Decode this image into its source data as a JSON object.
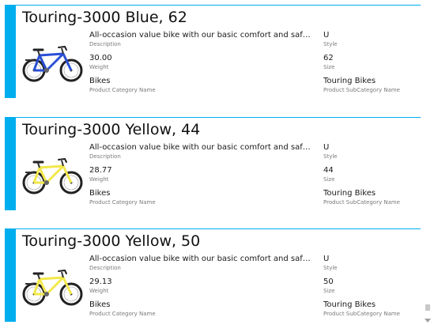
{
  "cards": [
    {
      "title": "Touring-3000 Blue, 62",
      "bike_color": "#2a4fd6",
      "description": {
        "value": "All-occasion value bike with our basic comfort and safety features. Wider, more stable tires for a ride around town or weekend trip.",
        "label": "Description"
      },
      "weight": {
        "value": "30.00",
        "label": "Weight"
      },
      "category": {
        "value": "Bikes",
        "label": "Product Category Name"
      },
      "style": {
        "value": "U",
        "label": "Style"
      },
      "size": {
        "value": "62",
        "label": "Size"
      },
      "subcategory": {
        "value": "Touring Bikes",
        "label": "Product SubCategory Name"
      }
    },
    {
      "title": "Touring-3000 Yellow, 44",
      "bike_color": "#f3e84a",
      "description": {
        "value": "All-occasion value bike with our basic comfort and safety features. Wider, more stable tires for a ride around town or weekend trip.",
        "label": "Description"
      },
      "weight": {
        "value": "28.77",
        "label": "Weight"
      },
      "category": {
        "value": "Bikes",
        "label": "Product Category Name"
      },
      "style": {
        "value": "U",
        "label": "Style"
      },
      "size": {
        "value": "44",
        "label": "Size"
      },
      "subcategory": {
        "value": "Touring Bikes",
        "label": "Product SubCategory Name"
      }
    },
    {
      "title": "Touring-3000 Yellow, 50",
      "bike_color": "#f3e84a",
      "description": {
        "value": "All-occasion value bike with our basic comfort and safety features. Wider, more stable tires for a ride around town or weekend trip.",
        "label": "Description"
      },
      "weight": {
        "value": "29.13",
        "label": "Weight"
      },
      "category": {
        "value": "Bikes",
        "label": "Product Category Name"
      },
      "style": {
        "value": "U",
        "label": "Style"
      },
      "size": {
        "value": "50",
        "label": "Size"
      },
      "subcategory": {
        "value": "Touring Bikes",
        "label": "Product SubCategory Name"
      }
    }
  ],
  "accent_color": "#00aeef",
  "scrollbar": {
    "down_icon": "chevron-down-icon"
  }
}
